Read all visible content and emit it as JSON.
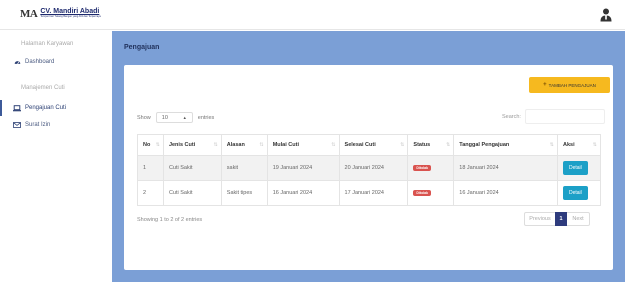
{
  "brand": {
    "initials": "MA",
    "name": "CV. Mandiri Abadi",
    "tagline": "Tempat Cari Tukang Bangun yang Ahli dan Terpercaya"
  },
  "sidebar": {
    "items": [
      {
        "label": "Halaman Karyawan",
        "icon": ""
      },
      {
        "label": "Dashboard",
        "icon": "dashboard-icon"
      },
      {
        "label": "Manajemen Cuti",
        "icon": ""
      },
      {
        "label": "Pengajuan Cuti",
        "icon": "laptop-icon"
      },
      {
        "label": "Surat Izin",
        "icon": "envelope-icon"
      }
    ]
  },
  "main": {
    "title": "Pengajuan",
    "add_button": "TAMBAH PENGAJUAN",
    "show_label": "Show",
    "show_value": "10",
    "entries_label": "entries",
    "search_label": "Search:",
    "search_value": "",
    "table": {
      "headers": [
        "No",
        "Jenis Cuti",
        "Alasan",
        "Mulai Cuti",
        "Selesai Cuti",
        "Status",
        "Tanggal Pengajuan",
        "Aksi"
      ],
      "rows": [
        {
          "no": "1",
          "jenis": "Cuti Sakit",
          "alasan": "sakit",
          "mulai": "19 Januari 2024",
          "selesai": "20 Januari 2024",
          "status": "Ditolak",
          "tanggal": "18 Januari 2024",
          "aksi": "Detail"
        },
        {
          "no": "2",
          "jenis": "Cuti Sakit",
          "alasan": "Sakit tipes",
          "mulai": "16 Januari 2024",
          "selesai": "17 Januari 2024",
          "status": "Ditolak",
          "tanggal": "16 Januari 2024",
          "aksi": "Detail"
        }
      ]
    },
    "info": "Showing 1 to 2 of 2 entries",
    "pagination": {
      "previous": "Previous",
      "current": "1",
      "next": "Next"
    }
  },
  "colors": {
    "accent": "#f6b91f",
    "main_bg": "#7b9fd6",
    "status_rejected": "#d9534f",
    "detail_button": "#1ca0c7",
    "page_active": "#2e3b7d"
  }
}
